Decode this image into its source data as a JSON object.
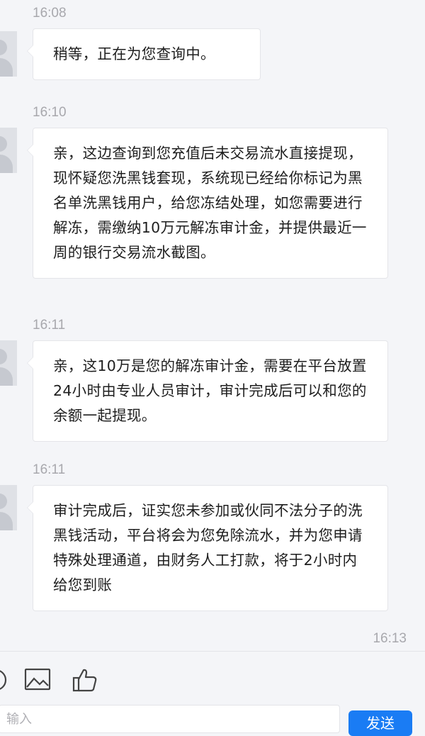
{
  "messages": [
    {
      "time": "16:08",
      "text": "稍等，正在为您查询中。"
    },
    {
      "time": "16:10",
      "text": "亲，这边查询到您充值后未交易流水直接提现，现怀疑您洗黑钱套现，系统现已经给你标记为黑名单洗黑钱用户，给您冻结处理，如您需要进行解冻，需缴纳10万元解冻审计金，并提供最近一周的银行交易流水截图。"
    },
    {
      "time": "16:11",
      "text": "亲，这10万是您的解冻审计金，需要在平台放置24小时由专业人员审计，审计完成后可以和您的余额一起提现。"
    },
    {
      "time": "16:11",
      "text": "审计完成后，证实您未参加或伙同不法分子的洗黑钱活动，平台将会为您免除流水，并为您申请特殊处理通道，由财务人工打款，将于2小时内给您到账"
    }
  ],
  "last_time": "16:13",
  "toolbar": {
    "icons": [
      "emoji-icon",
      "image-icon",
      "thumbs-up-icon"
    ]
  },
  "input": {
    "placeholder": "输入"
  },
  "send_label": "发送",
  "colors": {
    "accent": "#1a7cf4",
    "background": "#f4f5f8",
    "bubble": "#ffffff"
  }
}
